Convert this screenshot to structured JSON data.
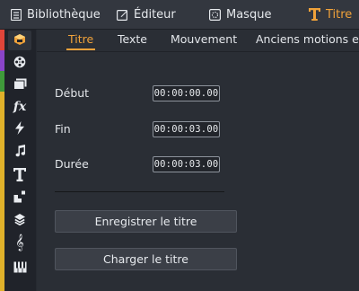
{
  "top_tabs": [
    {
      "label": "Bibliothèque",
      "icon": "library-icon"
    },
    {
      "label": "Éditeur",
      "icon": "edit-icon"
    },
    {
      "label": "Masque",
      "icon": "mask-icon"
    },
    {
      "label": "Titre",
      "icon": "title-icon",
      "active": true
    }
  ],
  "sidebar": {
    "items": [
      {
        "icon": "toolbox-icon",
        "active": true
      },
      {
        "icon": "film-reel-icon"
      },
      {
        "icon": "folders-icon"
      },
      {
        "icon": "fx-icon"
      },
      {
        "icon": "lightning-icon"
      },
      {
        "icon": "music-note-icon"
      },
      {
        "icon": "text-icon"
      },
      {
        "icon": "transition-icon"
      },
      {
        "icon": "layers-icon"
      },
      {
        "icon": "treble-clef-icon"
      },
      {
        "icon": "piano-icon"
      }
    ],
    "rail_colors": [
      "#e0453a",
      "#8a44c8",
      "#3f9a3a",
      "#e0b12a"
    ]
  },
  "sub_tabs": [
    "Titre",
    "Texte",
    "Mouvement",
    "Anciens motions et ca"
  ],
  "fields": {
    "start_label": "Début",
    "start_value": "00:00:00.00",
    "end_label": "Fin",
    "end_value": "00:00:03.00",
    "duration_label": "Durée",
    "duration_value": "00:00:03.00"
  },
  "buttons": {
    "save": "Enregistrer le titre",
    "load": "Charger le titre"
  },
  "colors": {
    "accent": "#f0a23a",
    "background": "#2a2e35",
    "sidebar": "#20232a"
  }
}
